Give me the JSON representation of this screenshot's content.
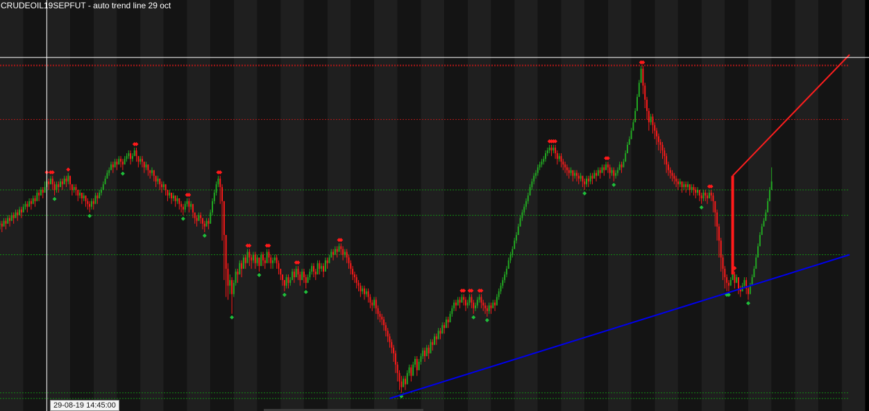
{
  "title": "CRUDEOIL19SEPFUT - auto trend line 29 oct",
  "crosshair": {
    "time_label": "29-08-19 14:45:00"
  },
  "colors": {
    "background": "#000000",
    "band_light": "#1f1f1f",
    "band_dark": "#141414",
    "up_candle": "#22aa22",
    "down_candle": "#ff1a1a",
    "high_marker": "#ff1a1a",
    "low_marker": "#1fbf3a",
    "resistance_trendline": "#ff1e1e",
    "support_trendline": "#0000ee",
    "resistance_level": "#b81818",
    "support_level": "#138a13",
    "crosshair": "#ffffff"
  },
  "chart_data": {
    "type": "candlestick",
    "symbol": "CRUDEOIL19SEPFUT",
    "series": [
      {
        "name": "price",
        "close": [
          100,
          99,
          101,
          100,
          102,
          101,
          103,
          102,
          104,
          103,
          105,
          104,
          106,
          107,
          106,
          108,
          107,
          109,
          108,
          111,
          110,
          112,
          111,
          113,
          115,
          114,
          116,
          114,
          112,
          114,
          113,
          115,
          114,
          116,
          115,
          117,
          114,
          112,
          113,
          112,
          110,
          111,
          109,
          110,
          108,
          107,
          106,
          108,
          107,
          110,
          109,
          111,
          112,
          114,
          116,
          118,
          119,
          121,
          120,
          122,
          121,
          123,
          122,
          121,
          123,
          124,
          125,
          123,
          124,
          126,
          124,
          122,
          123,
          122,
          120,
          121,
          119,
          118,
          119,
          117,
          115,
          116,
          114,
          113,
          114,
          112,
          110,
          111,
          109,
          110,
          108,
          109,
          107,
          106,
          105,
          107,
          108,
          106,
          107,
          104,
          102,
          101,
          103,
          102,
          100,
          99,
          101,
          100,
          104,
          108,
          111,
          114,
          116,
          113,
          108,
          96,
          84,
          78,
          80,
          75,
          79,
          83,
          82,
          86,
          84,
          88,
          86,
          90,
          88,
          87,
          89,
          86,
          88,
          85,
          89,
          87,
          86,
          90,
          88,
          86,
          87,
          88,
          86,
          84,
          82,
          80,
          78,
          81,
          79,
          80,
          83,
          81,
          84,
          82,
          80,
          83,
          81,
          79,
          81,
          83,
          85,
          83,
          82,
          86,
          84,
          85,
          83,
          87,
          86,
          88,
          90,
          89,
          91,
          90,
          92,
          91,
          89,
          90,
          88,
          86,
          84,
          82,
          81,
          79,
          78,
          76,
          77,
          75,
          76,
          74,
          72,
          71,
          73,
          70,
          68,
          67,
          66,
          64,
          62,
          60,
          58,
          56,
          54,
          50,
          47,
          44,
          42,
          45,
          43,
          47,
          49,
          46,
          50,
          52,
          48,
          51,
          53,
          55,
          53,
          56,
          54,
          58,
          57,
          60,
          59,
          62,
          61,
          64,
          63,
          66,
          65,
          68,
          70,
          72,
          71,
          73,
          72,
          74,
          73,
          71,
          72,
          74,
          72,
          70,
          71,
          73,
          74,
          72,
          71,
          70,
          69,
          71,
          70,
          72,
          71,
          74,
          76,
          78,
          80,
          82,
          84,
          87,
          89,
          91,
          94,
          96,
          99,
          102,
          104,
          106,
          108,
          110,
          113,
          115,
          117,
          118,
          120,
          121,
          122,
          123,
          125,
          126,
          127,
          126,
          127,
          125,
          123,
          124,
          122,
          121,
          120,
          119,
          118,
          119,
          117,
          118,
          117,
          116,
          117,
          115,
          114,
          116,
          115,
          117,
          116,
          118,
          117,
          119,
          118,
          120,
          119,
          121,
          120,
          118,
          119,
          117,
          118,
          119,
          121,
          120,
          122,
          125,
          128,
          130,
          133,
          136,
          140,
          145,
          150,
          155,
          149,
          144,
          140,
          136,
          138,
          135,
          133,
          131,
          129,
          128,
          126,
          124,
          121,
          119,
          118,
          117,
          116,
          115,
          114,
          115,
          113,
          114,
          113,
          114,
          112,
          113,
          112,
          111,
          112,
          110,
          109,
          111,
          110,
          109,
          111,
          110,
          108,
          104,
          99,
          94,
          88,
          84,
          81,
          79,
          78,
          80,
          82,
          79,
          81,
          77,
          76,
          78,
          80,
          77,
          75,
          78,
          81,
          84,
          88,
          92,
          96,
          99,
          101,
          104,
          108,
          112,
          115
        ],
        "high": [
          101,
          101,
          102,
          102,
          103,
          103,
          104,
          104,
          105,
          105,
          106,
          106,
          107,
          108,
          108,
          109,
          109,
          110,
          110,
          112,
          112,
          113,
          113,
          115,
          117,
          116,
          117,
          117,
          115,
          115,
          115,
          116,
          116,
          117,
          117,
          118,
          117,
          114,
          114,
          114,
          112,
          112,
          111,
          111,
          110,
          109,
          108,
          109,
          109,
          111,
          111,
          112,
          113,
          115,
          117,
          119,
          120,
          122,
          122,
          123,
          123,
          124,
          124,
          123,
          124,
          125,
          126,
          126,
          125,
          127,
          127,
          124,
          124,
          124,
          122,
          122,
          121,
          119,
          120,
          119,
          117,
          117,
          116,
          115,
          115,
          114,
          112,
          112,
          111,
          111,
          110,
          110,
          109,
          108,
          107,
          108,
          109,
          109,
          108,
          107,
          104,
          103,
          104,
          104,
          102,
          101,
          102,
          102,
          105,
          109,
          112,
          115,
          117,
          117,
          114,
          108,
          96,
          86,
          82,
          81,
          80,
          84,
          84,
          87,
          87,
          89,
          89,
          91,
          91,
          89,
          90,
          90,
          89,
          88,
          90,
          90,
          88,
          91,
          91,
          89,
          88,
          89,
          89,
          87,
          84,
          82,
          80,
          82,
          82,
          81,
          84,
          84,
          85,
          85,
          83,
          84,
          84,
          82,
          82,
          84,
          86,
          86,
          84,
          87,
          87,
          86,
          86,
          88,
          88,
          89,
          91,
          91,
          92,
          92,
          93,
          93,
          92,
          91,
          91,
          89,
          87,
          85,
          83,
          82,
          80,
          79,
          78,
          78,
          77,
          77,
          75,
          73,
          74,
          74,
          71,
          69,
          68,
          67,
          65,
          63,
          61,
          59,
          57,
          55,
          51,
          48,
          46,
          46,
          46,
          48,
          50,
          50,
          51,
          53,
          53,
          52,
          54,
          56,
          56,
          57,
          57,
          59,
          59,
          61,
          61,
          63,
          63,
          65,
          65,
          67,
          67,
          69,
          71,
          73,
          73,
          74,
          74,
          75,
          75,
          74,
          73,
          75,
          75,
          73,
          72,
          74,
          75,
          75,
          73,
          72,
          71,
          72,
          72,
          73,
          73,
          75,
          77,
          79,
          81,
          83,
          85,
          88,
          90,
          92,
          95,
          97,
          100,
          103,
          105,
          107,
          109,
          111,
          114,
          116,
          118,
          119,
          121,
          122,
          123,
          124,
          126,
          127,
          128,
          128,
          128,
          128,
          126,
          125,
          125,
          123,
          122,
          121,
          120,
          120,
          119,
          119,
          119,
          118,
          118,
          117,
          116,
          117,
          117,
          118,
          118,
          119,
          119,
          120,
          120,
          121,
          121,
          122,
          122,
          121,
          120,
          120,
          119,
          120,
          122,
          122,
          123,
          126,
          129,
          131,
          134,
          137,
          141,
          146,
          151,
          156,
          156,
          150,
          145,
          141,
          139,
          139,
          136,
          134,
          132,
          130,
          129,
          127,
          125,
          122,
          120,
          119,
          118,
          117,
          116,
          116,
          115,
          115,
          115,
          115,
          114,
          114,
          114,
          113,
          113,
          112,
          111,
          112,
          112,
          111,
          112,
          112,
          111,
          108,
          105,
          100,
          95,
          89,
          85,
          82,
          80,
          81,
          83,
          83,
          82,
          81,
          78,
          79,
          81,
          81,
          78,
          79,
          82,
          85,
          89,
          93,
          97,
          100,
          102,
          105,
          109,
          113,
          120
        ],
        "low": [
          98,
          97,
          99,
          98,
          100,
          99,
          101,
          100,
          102,
          101,
          103,
          102,
          104,
          105,
          104,
          106,
          105,
          107,
          106,
          108,
          108,
          110,
          109,
          111,
          113,
          112,
          114,
          112,
          110,
          111,
          111,
          113,
          112,
          114,
          113,
          114,
          112,
          110,
          111,
          110,
          108,
          109,
          107,
          108,
          106,
          105,
          104,
          105,
          105,
          107,
          107,
          109,
          110,
          112,
          114,
          116,
          117,
          119,
          118,
          120,
          119,
          121,
          120,
          119,
          121,
          122,
          123,
          121,
          122,
          124,
          122,
          120,
          121,
          120,
          118,
          119,
          117,
          116,
          117,
          115,
          113,
          114,
          112,
          111,
          112,
          110,
          108,
          109,
          107,
          108,
          106,
          107,
          105,
          104,
          103,
          104,
          106,
          104,
          105,
          102,
          100,
          99,
          101,
          100,
          98,
          97,
          99,
          98,
          100,
          103,
          107,
          110,
          113,
          107,
          94,
          80,
          74,
          73,
          75,
          68,
          74,
          78,
          79,
          82,
          81,
          85,
          84,
          87,
          85,
          84,
          86,
          84,
          85,
          83,
          85,
          85,
          84,
          86,
          86,
          84,
          84,
          86,
          84,
          82,
          80,
          78,
          76,
          77,
          77,
          78,
          80,
          79,
          81,
          80,
          78,
          80,
          79,
          77,
          79,
          80,
          82,
          81,
          80,
          83,
          82,
          83,
          81,
          84,
          84,
          86,
          88,
          87,
          89,
          88,
          90,
          89,
          87,
          88,
          86,
          84,
          82,
          80,
          79,
          77,
          76,
          74,
          75,
          73,
          74,
          72,
          70,
          69,
          70,
          68,
          66,
          65,
          64,
          62,
          60,
          58,
          56,
          54,
          51,
          47,
          44,
          41,
          40,
          42,
          41,
          44,
          46,
          44,
          47,
          49,
          46,
          48,
          50,
          52,
          51,
          53,
          52,
          55,
          55,
          57,
          57,
          59,
          59,
          61,
          61,
          63,
          63,
          65,
          67,
          69,
          69,
          71,
          70,
          72,
          71,
          69,
          70,
          71,
          70,
          68,
          69,
          70,
          72,
          70,
          69,
          68,
          67,
          68,
          68,
          70,
          69,
          71,
          73,
          75,
          77,
          79,
          81,
          84,
          86,
          88,
          91,
          93,
          96,
          99,
          101,
          103,
          105,
          107,
          110,
          112,
          114,
          116,
          117,
          119,
          120,
          121,
          122,
          124,
          125,
          124,
          125,
          123,
          121,
          122,
          120,
          119,
          118,
          117,
          116,
          117,
          115,
          116,
          115,
          114,
          115,
          113,
          112,
          113,
          113,
          114,
          114,
          116,
          115,
          117,
          116,
          118,
          117,
          119,
          118,
          116,
          117,
          115,
          116,
          117,
          119,
          118,
          120,
          122,
          125,
          128,
          130,
          133,
          136,
          140,
          145,
          150,
          146,
          141,
          137,
          133,
          135,
          132,
          130,
          128,
          126,
          125,
          123,
          121,
          118,
          117,
          116,
          115,
          114,
          113,
          112,
          113,
          111,
          112,
          111,
          112,
          110,
          111,
          110,
          109,
          110,
          108,
          107,
          108,
          108,
          107,
          109,
          108,
          104,
          99,
          94,
          88,
          83,
          80,
          77,
          76,
          76,
          78,
          80,
          77,
          79,
          75,
          74,
          76,
          77,
          75,
          73,
          75,
          78,
          81,
          84,
          88,
          92,
          96,
          99,
          101,
          105,
          108,
          112
        ]
      }
    ],
    "trendlines": [
      {
        "name": "resistance",
        "color": "#ff1e1e",
        "from": [
          376,
          117
        ],
        "to": [
          436,
          160
        ]
      },
      {
        "name": "support",
        "color": "#0000ee",
        "from": [
          200,
          38
        ],
        "to": [
          436,
          89
        ]
      }
    ],
    "horizontal_levels": [
      {
        "value": 137,
        "color": "#b81818",
        "style": "dotted"
      },
      {
        "value": 156,
        "color": "#b81818",
        "style": "dotted"
      },
      {
        "value": 156.3,
        "color": "#b81818",
        "style": "dotted"
      },
      {
        "value": 112,
        "color": "#138a13",
        "style": "dotted"
      },
      {
        "value": 103,
        "color": "#138a13",
        "style": "dotted"
      },
      {
        "value": 40,
        "color": "#138a13",
        "style": "dotted"
      },
      {
        "value": 38,
        "color": "#138a13",
        "style": "dotted"
      },
      {
        "value": 89,
        "color": "#138a13",
        "style": "dotted"
      }
    ],
    "ylim": [
      36,
      172
    ],
    "xlim": [
      0,
      436
    ],
    "crosshair": {
      "x": 24,
      "y": 159
    },
    "band_width": 12,
    "grid": false,
    "xlabel": "",
    "ylabel": ""
  }
}
